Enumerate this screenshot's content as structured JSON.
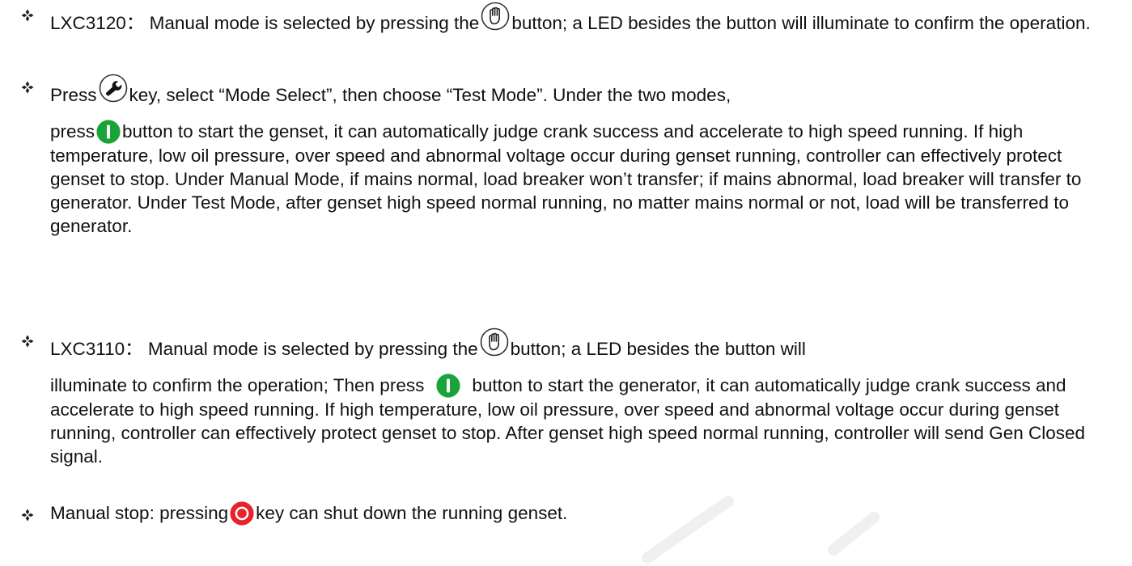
{
  "items": [
    {
      "parts": [
        "LXC3120： Manual mode is selected by pressing the",
        "button; a LED besides the button will illuminate to confirm the operation."
      ]
    },
    {
      "parts": [
        "Press",
        "key, select “Mode Select”, then choose “Test Mode”. Under the two modes,",
        "press",
        "button to start the genset, it can automatically judge crank success and accelerate to high speed running. If high temperature, low oil pressure, over speed and abnormal voltage occur during genset running, controller can effectively protect genset to stop. Under Manual Mode, if mains normal, load breaker won’t transfer; if mains abnormal, load breaker will transfer to generator. Under Test Mode, after genset high speed normal running, no matter mains normal or not, load will be transferred to generator."
      ]
    },
    {
      "parts": [
        "LXC3110： Manual mode is selected by pressing the",
        "button; a LED besides the button will",
        "illuminate to confirm the operation; Then press",
        "button to start the generator, it can automatically judge crank success and accelerate to high speed running. If high temperature, low oil pressure, over speed and abnormal voltage occur during genset running, controller can effectively protect genset to stop. After genset high speed normal running, controller will send Gen Closed signal."
      ]
    },
    {
      "parts": [
        "Manual stop: pressing",
        "key can shut down the running genset."
      ]
    }
  ],
  "icons": {
    "bullet": "four-diamond-bullet-icon",
    "manual": "hand-button-icon",
    "settings": "wrench-key-icon",
    "start": "green-start-button-icon",
    "stop": "red-stop-button-icon"
  },
  "colors": {
    "text": "#111111",
    "start_green": "#19a43a",
    "stop_red": "#e8222a",
    "icon_outline": "#333333",
    "watermark": "#f0f0f0"
  }
}
